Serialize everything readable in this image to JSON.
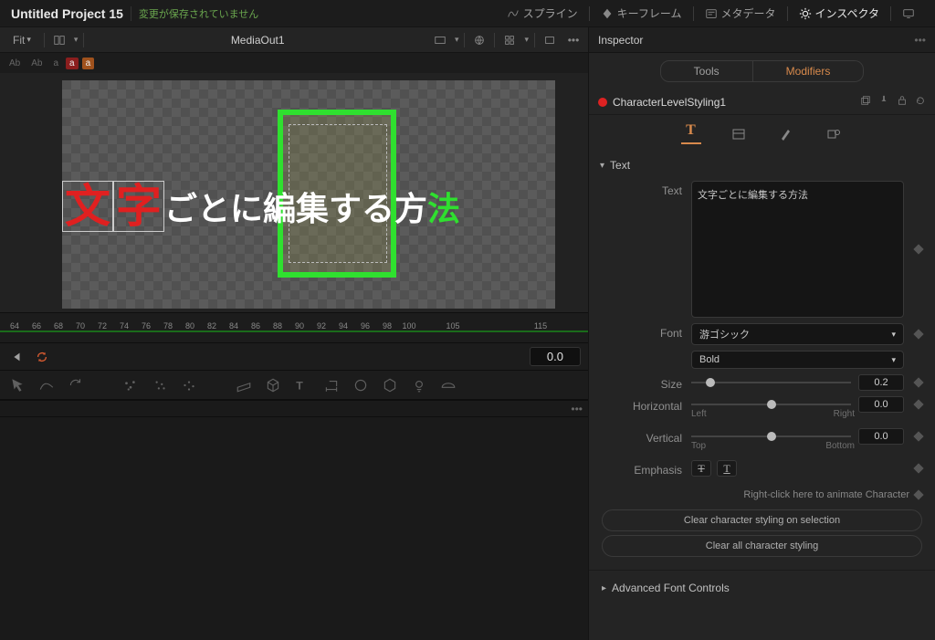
{
  "header": {
    "project_title": "Untitled Project 15",
    "unsaved_msg": "変更が保存されていません",
    "nav_spline": "スプライン",
    "nav_keyframes": "キーフレーム",
    "nav_metadata": "メタデータ",
    "nav_inspector": "インスペクタ"
  },
  "viewer": {
    "fit_label": "Fit",
    "node_title": "MediaOut1",
    "timecode": "0.0",
    "ruler_ticks": [
      "64",
      "66",
      "68",
      "70",
      "72",
      "74",
      "76",
      "78",
      "80",
      "82",
      "84",
      "86",
      "88",
      "90",
      "92",
      "94",
      "96",
      "98",
      "100",
      "",
      "105",
      "",
      "",
      "",
      "115",
      ""
    ],
    "sample_text_c1": "文",
    "sample_text_c2": "字",
    "sample_text_rest": "ごとに編集する方",
    "sample_text_last": "法"
  },
  "inspector": {
    "panel_title": "Inspector",
    "tab_tools": "Tools",
    "tab_modifiers": "Modifiers",
    "node_name": "CharacterLevelStyling1",
    "section_text": "Text",
    "label_text": "Text",
    "text_value": "文字ごとに編集する方法",
    "label_font": "Font",
    "font_family": "游ゴシック",
    "font_weight": "Bold",
    "label_size": "Size",
    "size_value": "0.2",
    "label_horiz": "Horizontal",
    "horiz_value": "0.0",
    "horiz_left": "Left",
    "horiz_right": "Right",
    "label_vert": "Vertical",
    "vert_value": "0.0",
    "vert_top": "Top",
    "vert_bottom": "Bottom",
    "label_emph": "Emphasis",
    "animate_hint": "Right-click here to animate Character",
    "btn_clear_sel": "Clear character styling on selection",
    "btn_clear_all": "Clear all character styling",
    "section_adv": "Advanced Font Controls"
  }
}
